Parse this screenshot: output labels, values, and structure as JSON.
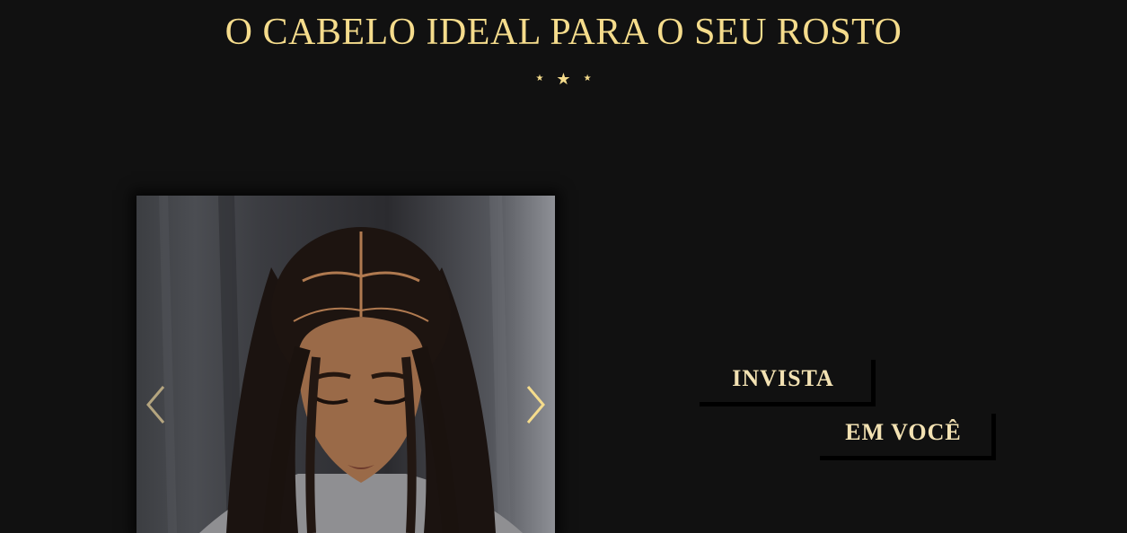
{
  "section": {
    "title": "O CABELO IDEAL PARA O SEU ROSTO",
    "stars": [
      "★",
      "★",
      "★"
    ]
  },
  "carousel": {
    "prev_icon": "chevron-left-icon",
    "next_icon": "chevron-right-icon"
  },
  "promo": {
    "line1": "INVISTA",
    "line2": "EM VOCÊ"
  },
  "colors": {
    "background": "#111111",
    "accent_gold": "#f5dc8c",
    "promo_text": "#f3e2b3"
  }
}
